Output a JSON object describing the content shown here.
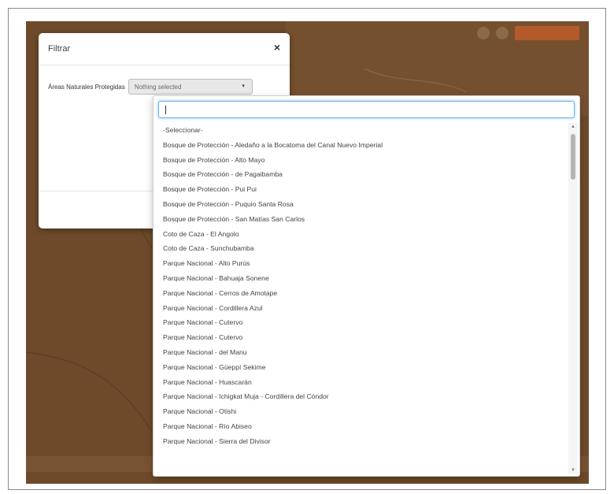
{
  "modal": {
    "title": "Filtrar",
    "close_symbol": "×",
    "filter_label": "Áreas Naturales Protegidas",
    "select_value": "Nothing selected",
    "select_caret": "▾"
  },
  "dropdown": {
    "search_value": "",
    "options": [
      "-Seleccionar-",
      "Bosque de Protección - Aledaño a la Bocatoma del Canal Nuevo Imperial",
      "Bosque de Protección - Alto Mayo",
      "Bosque de Protección - de Pagaibamba",
      "Bosque de Protección - Pui Pui",
      "Bosque de Protección - Puquio Santa Rosa",
      "Bosque de Protección - San Matías San Carlos",
      "Coto de Caza - El Angolo",
      "Coto de Caza - Sunchubamba",
      "Parque Nacional - Alto Purús",
      "Parque Nacional - Bahuaja Sonene",
      "Parque Nacional - Cerros de Amotape",
      "Parque Nacional - Cordillera Azul",
      "Parque Nacional - Cutervo",
      "Parque Nacional - Cutervo",
      "Parque Nacional - del Manu",
      "Parque Nacional - Güeppí Sekime",
      "Parque Nacional - Huascarán",
      "Parque Nacional - Ichigkat Muja - Cordillera del Cóndor",
      "Parque Nacional - Otishi",
      "Parque Nacional - Río Abiseo",
      "Parque Nacional - Sierra del Divisor"
    ],
    "scroll_up": "▲",
    "scroll_down": "▼"
  },
  "colors": {
    "map_background": "#6e4a2a",
    "focus_border": "#66afe9"
  },
  "icons": [
    "close-icon",
    "chevron-down-icon",
    "scroll-up-icon",
    "scroll-down-icon"
  ]
}
